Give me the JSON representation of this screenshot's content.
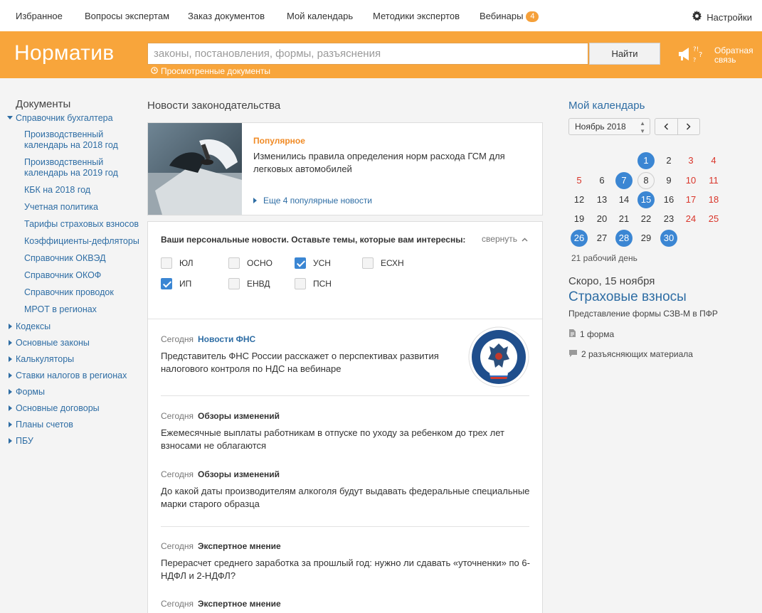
{
  "topnav": {
    "items": [
      "Избранное",
      "Вопросы экспертам",
      "Заказ  документов",
      "Мой календарь",
      "Методики экспертов",
      "Вебинары"
    ],
    "webinars_badge": "4",
    "settings_label": "Настройки"
  },
  "header": {
    "logo": "Норматив",
    "search_placeholder": "законы, постановления, формы, разъяснения",
    "find_label": "Найти",
    "viewed_label": "Просмотренные документы",
    "feedback_label": "Обратная связь",
    "brand_color": "#f8a53b"
  },
  "sidebar": {
    "title": "Документы",
    "expanded": {
      "label": "Справочник бухгалтера",
      "children": [
        "Производственный календарь на 2018 год",
        "Производственный календарь на 2019 год",
        "КБК на 2018 год",
        "Учетная политика",
        "Тарифы страховых взносов",
        "Коэффициенты-дефляторы",
        "Справочник ОКВЭД",
        "Справочник ОКОФ",
        "Справочник проводок",
        "МРОТ в регионах"
      ]
    },
    "collapsed": [
      "Кодексы",
      "Основные законы",
      "Калькуляторы",
      "Ставки налогов в регионах",
      "Формы",
      "Основные договоры",
      "Планы счетов",
      "ПБУ"
    ]
  },
  "news_section": {
    "title": "Новости законодательства",
    "popular": {
      "tag": "Популярное",
      "headline": "Изменились правила определения норм расхода ГСМ для легковых автомобилей",
      "more": "Еще 4 популярные новости"
    },
    "personal": {
      "title": "Ваши персональные новости. Оставьте темы, которые вам интересны:",
      "collapse_label": "свернуть",
      "topics": [
        {
          "label": "ЮЛ",
          "checked": false
        },
        {
          "label": "ОСНО",
          "checked": false
        },
        {
          "label": "УСН",
          "checked": true
        },
        {
          "label": "ЕСХН",
          "checked": false
        },
        {
          "label": "ИП",
          "checked": true
        },
        {
          "label": "ЕНВД",
          "checked": false
        },
        {
          "label": "ПСН",
          "checked": false
        }
      ]
    },
    "items": [
      {
        "date": "Сегодня",
        "category": "Новости ФНС",
        "title": "Представитель ФНС России расскажет о перспективах развития налогового контроля по НДС на вебинаре"
      },
      {
        "date": "Сегодня",
        "category": "Обзоры изменений",
        "title": "Ежемесячные выплаты работникам в отпуске по уходу за ребенком до трех лет взносами не облагаются"
      },
      {
        "date": "Сегодня",
        "category": "Обзоры изменений",
        "title": "До какой даты производителям алкоголя будут выдавать федеральные специальные марки старого образца"
      },
      {
        "date": "Сегодня",
        "category": "Экспертное мнение",
        "title": "Перерасчет среднего заработка за прошлый год: нужно ли сдавать «уточненки» по 6-НДФЛ и 2-НДФЛ?"
      },
      {
        "date": "Сегодня",
        "category": "Экспертное мнение",
        "title": ""
      }
    ]
  },
  "calendar": {
    "title": "Мой календарь",
    "month": "Ноябрь 2018",
    "days": [
      "1",
      "2",
      "3",
      "4",
      "5",
      "6",
      "7",
      "8",
      "9",
      "10",
      "11",
      "12",
      "13",
      "14",
      "15",
      "16",
      "17",
      "18",
      "19",
      "20",
      "21",
      "22",
      "23",
      "24",
      "25",
      "26",
      "27",
      "28",
      "29",
      "30"
    ],
    "workdays": "21 рабочий день",
    "soon": "Скоро, 15 ноября",
    "event_title": "Страховые взносы",
    "event_desc": "Представление формы СЗВ-М в ПФР",
    "resources": [
      "1 форма",
      "2 разъясняющих материала"
    ],
    "highlight_color": "#3b86d3",
    "weekend_color": "#d9352a"
  }
}
